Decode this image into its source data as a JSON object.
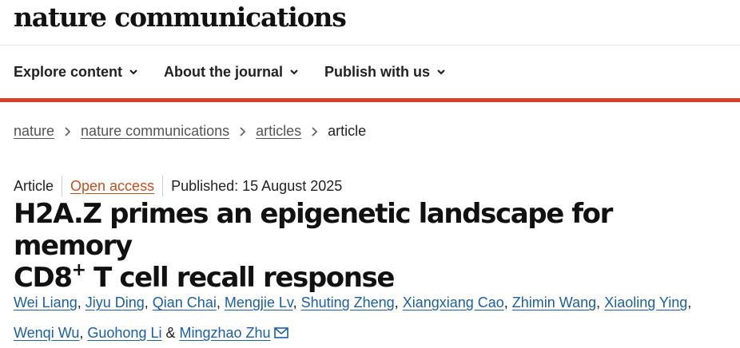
{
  "site": {
    "logo": "nature communications"
  },
  "nav": {
    "items": [
      {
        "label": "Explore content",
        "icon": "chevron-down-icon"
      },
      {
        "label": "About the journal",
        "icon": "chevron-down-icon"
      },
      {
        "label": "Publish with us",
        "icon": "chevron-down-icon"
      }
    ]
  },
  "colors": {
    "accent_bar": "#d8402c",
    "link": "#1b5fa8",
    "open_access": "#c4501d"
  },
  "breadcrumb": {
    "items": [
      "nature",
      "nature communications",
      "articles"
    ],
    "current": "article"
  },
  "article": {
    "type": "Article",
    "access": "Open access",
    "published": "Published: 15 August 2025",
    "title_line1": "H2A.Z primes an epigenetic landscape for memory",
    "title_line2_pre": "CD8",
    "title_line2_sup": "+",
    "title_line2_post": " T cell recall response",
    "authors": [
      "Wei Liang",
      "Jiyu Ding",
      "Qian Chai",
      "Mengjie Lv",
      "Shuting Zheng",
      "Xiangxiang Cao",
      "Zhimin Wang",
      "Xiaoling Ying",
      "Wenqi Wu",
      "Guohong Li",
      "Mingzhao Zhu"
    ],
    "author_separator": ", ",
    "author_last_separator": " & ",
    "corresponding_icon": "envelope-icon"
  }
}
